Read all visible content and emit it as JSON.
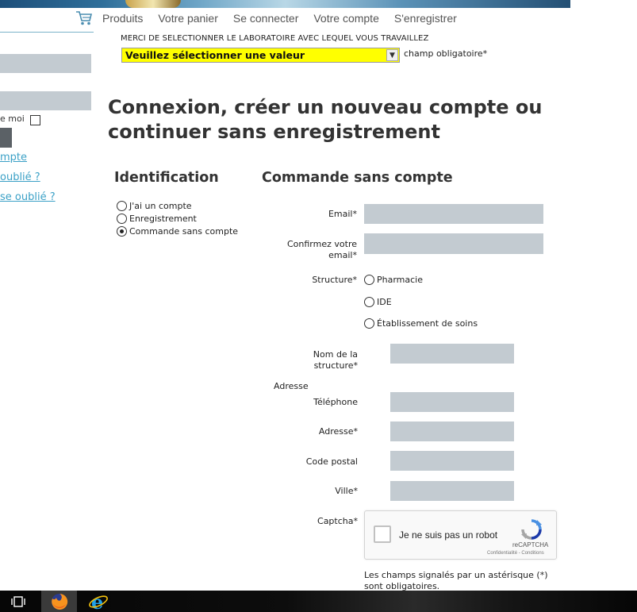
{
  "nav": {
    "cart_icon": "shopping-cart-icon",
    "items": [
      "Produits",
      "Votre panier",
      "Se connecter",
      "Votre compte",
      "S'enregistrer"
    ]
  },
  "sidebar": {
    "remember_label": "e moi",
    "links": [
      "mpte",
      "oublié ?",
      "se oublié ?"
    ]
  },
  "lab": {
    "label": "MERCI DE SELECTIONNER LE LABORATOIRE AVEC LEQUEL VOUS TRAVAILLEZ",
    "selected": "Veuillez sélectionner une valeur",
    "required": "champ obligatoire*"
  },
  "page_title": "Connexion, créer un nouveau compte ou continuer sans enregistrement",
  "identification": {
    "title": "Identification",
    "options": [
      {
        "label": "J'ai un compte",
        "checked": false
      },
      {
        "label": "Enregistrement",
        "checked": false
      },
      {
        "label": "Commande sans compte",
        "checked": true
      }
    ]
  },
  "form": {
    "title": "Commande sans compte",
    "email_label": "Email*",
    "confirm_email_label": "Confirmez votre email*",
    "structure_label": "Structure*",
    "structure_options": [
      "Pharmacie",
      "IDE",
      "Établissement de soins"
    ],
    "structure_name_label": "Nom de la structure*",
    "address_section": "Adresse",
    "phone_label": "Téléphone",
    "address_label": "Adresse*",
    "postal_label": "Code postal",
    "city_label": "Ville*",
    "captcha_label": "Captcha*",
    "required_note": "Les champs signalés par un astérisque (*) sont obligatoires."
  },
  "captcha": {
    "text": "Je ne suis pas un robot",
    "brand": "reCAPTCHA",
    "terms": "Confidentialité - Conditions"
  },
  "taskbar": {
    "icons": [
      "task-view-icon",
      "firefox-icon",
      "internet-explorer-icon"
    ]
  },
  "colors": {
    "field_bg": "#c3cbd1",
    "select_bg": "#ffff00",
    "link": "#3aa0c6",
    "text": "#333333"
  }
}
